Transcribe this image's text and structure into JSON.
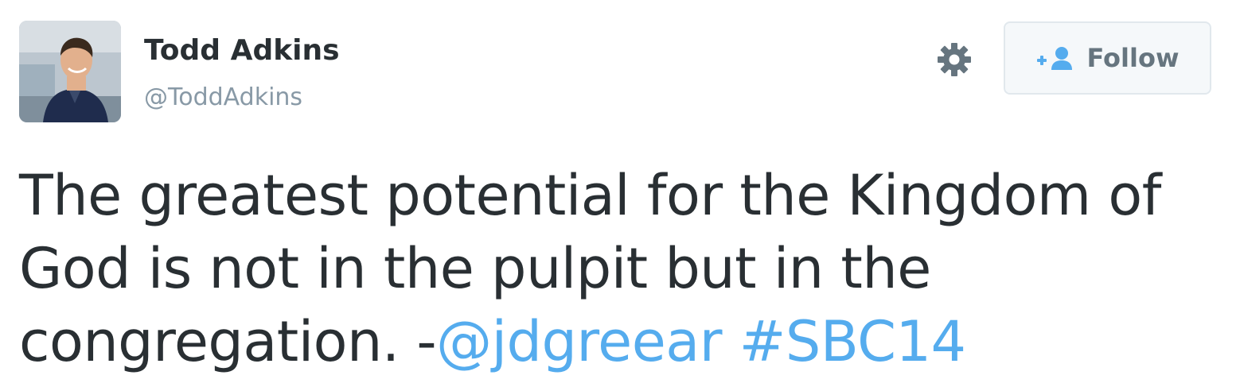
{
  "tweet": {
    "author": {
      "name": "Todd Adkins",
      "handle": "@ToddAdkins"
    },
    "actions": {
      "settings_icon": "gear-icon",
      "follow_icon": "add-user-icon",
      "follow_label": "Follow"
    },
    "text": {
      "line1": "The greatest potential for the Kingdom of",
      "line2": "God is not in the pulpit but in the",
      "line3_prefix": "congregation. -",
      "mention": "@jdgreear",
      "hashtag": "#SBC14"
    },
    "colors": {
      "link": "#55acee",
      "text": "#292f33",
      "muted": "#8899a6"
    }
  }
}
